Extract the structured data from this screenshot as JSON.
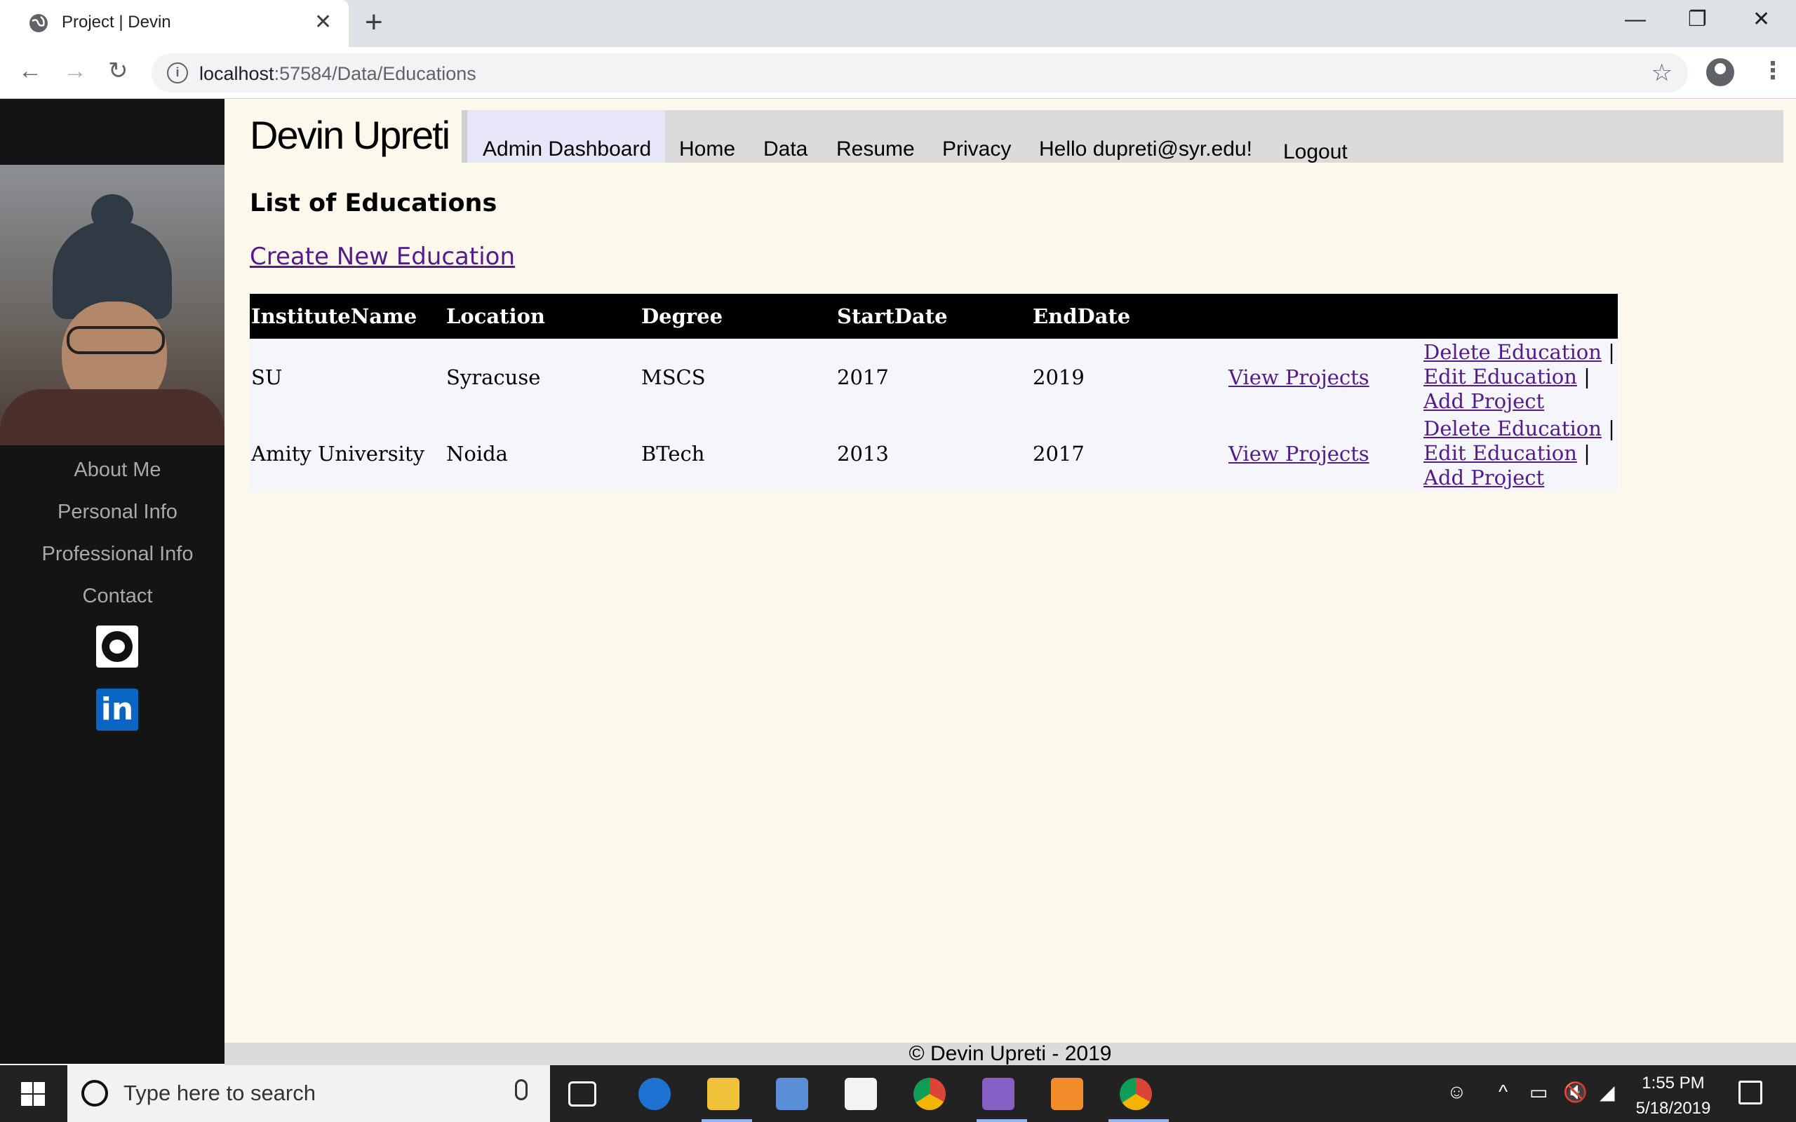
{
  "browser": {
    "tab_title": "Project | Devin",
    "new_tab_symbol": "+",
    "close_symbol": "✕",
    "url_host": "localhost",
    "url_rest": ":57584/Data/Educations",
    "window_controls": [
      "—",
      "❐",
      "✕"
    ]
  },
  "site": {
    "brand": "Devin Upreti",
    "nav": [
      "Admin Dashboard",
      "Home",
      "Data",
      "Resume",
      "Privacy",
      "Hello dupreti@syr.edu!",
      "Logout"
    ],
    "sidebar_links": [
      "About Me",
      "Personal Info",
      "Professional Info",
      "Contact"
    ],
    "linkedin_text": "in"
  },
  "page": {
    "title": "List of Educations",
    "create_link": "Create New Education",
    "table": {
      "headers": [
        "InstituteName",
        "Location",
        "Degree",
        "StartDate",
        "EndDate"
      ],
      "rows": [
        {
          "institute": "SU",
          "location": "Syracuse",
          "degree": "MSCS",
          "start": "2017",
          "end": "2019"
        },
        {
          "institute": "Amity University",
          "location": "Noida",
          "degree": "BTech",
          "start": "2013",
          "end": "2017"
        }
      ],
      "view_projects": "View Projects",
      "delete": "Delete Education",
      "edit": "Edit Education",
      "add_project": "Add Project",
      "separator": "|"
    }
  },
  "footer": "© Devin Upreti - 2019",
  "taskbar": {
    "search_placeholder": "Type here to search",
    "time": "1:55 PM",
    "date": "5/18/2019"
  },
  "colors": {
    "page_bg": "#fdf8ec",
    "sidebar_bg": "#141414",
    "link": "#551a8b",
    "nav_active": "#e6e6f8"
  }
}
